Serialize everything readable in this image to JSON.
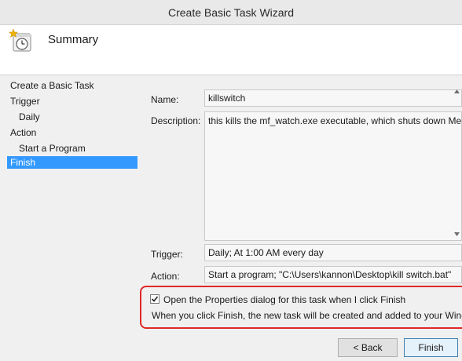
{
  "window": {
    "title": "Create Basic Task Wizard"
  },
  "header": {
    "title": "Summary",
    "icon": "clock-task-icon"
  },
  "nav": {
    "items": [
      {
        "label": "Create a Basic Task"
      },
      {
        "label": "Trigger"
      },
      {
        "label": "Daily"
      },
      {
        "label": "Action"
      },
      {
        "label": "Start a Program"
      },
      {
        "label": "Finish",
        "selected": true
      }
    ]
  },
  "summary": {
    "name_label": "Name:",
    "name_value": "killswitch",
    "description_label": "Description:",
    "description_value": "this kills the mf_watch.exe executable, which shuts down MediaF",
    "trigger_label": "Trigger:",
    "trigger_value": "Daily; At 1:00 AM every day",
    "action_label": "Action:",
    "action_value": "Start a program; \"C:\\Users\\kannon\\Desktop\\kill switch.bat\""
  },
  "options": {
    "open_properties_label": "Open the Properties dialog for this task when I click Finish",
    "open_properties_checked": true,
    "finish_note": "When you click Finish, the new task will be created and added to your Windows"
  },
  "buttons": {
    "back_label": "< Back",
    "finish_label": "Finish"
  },
  "colors": {
    "selected_nav": "#3399ff",
    "callout_border": "#e02828"
  }
}
